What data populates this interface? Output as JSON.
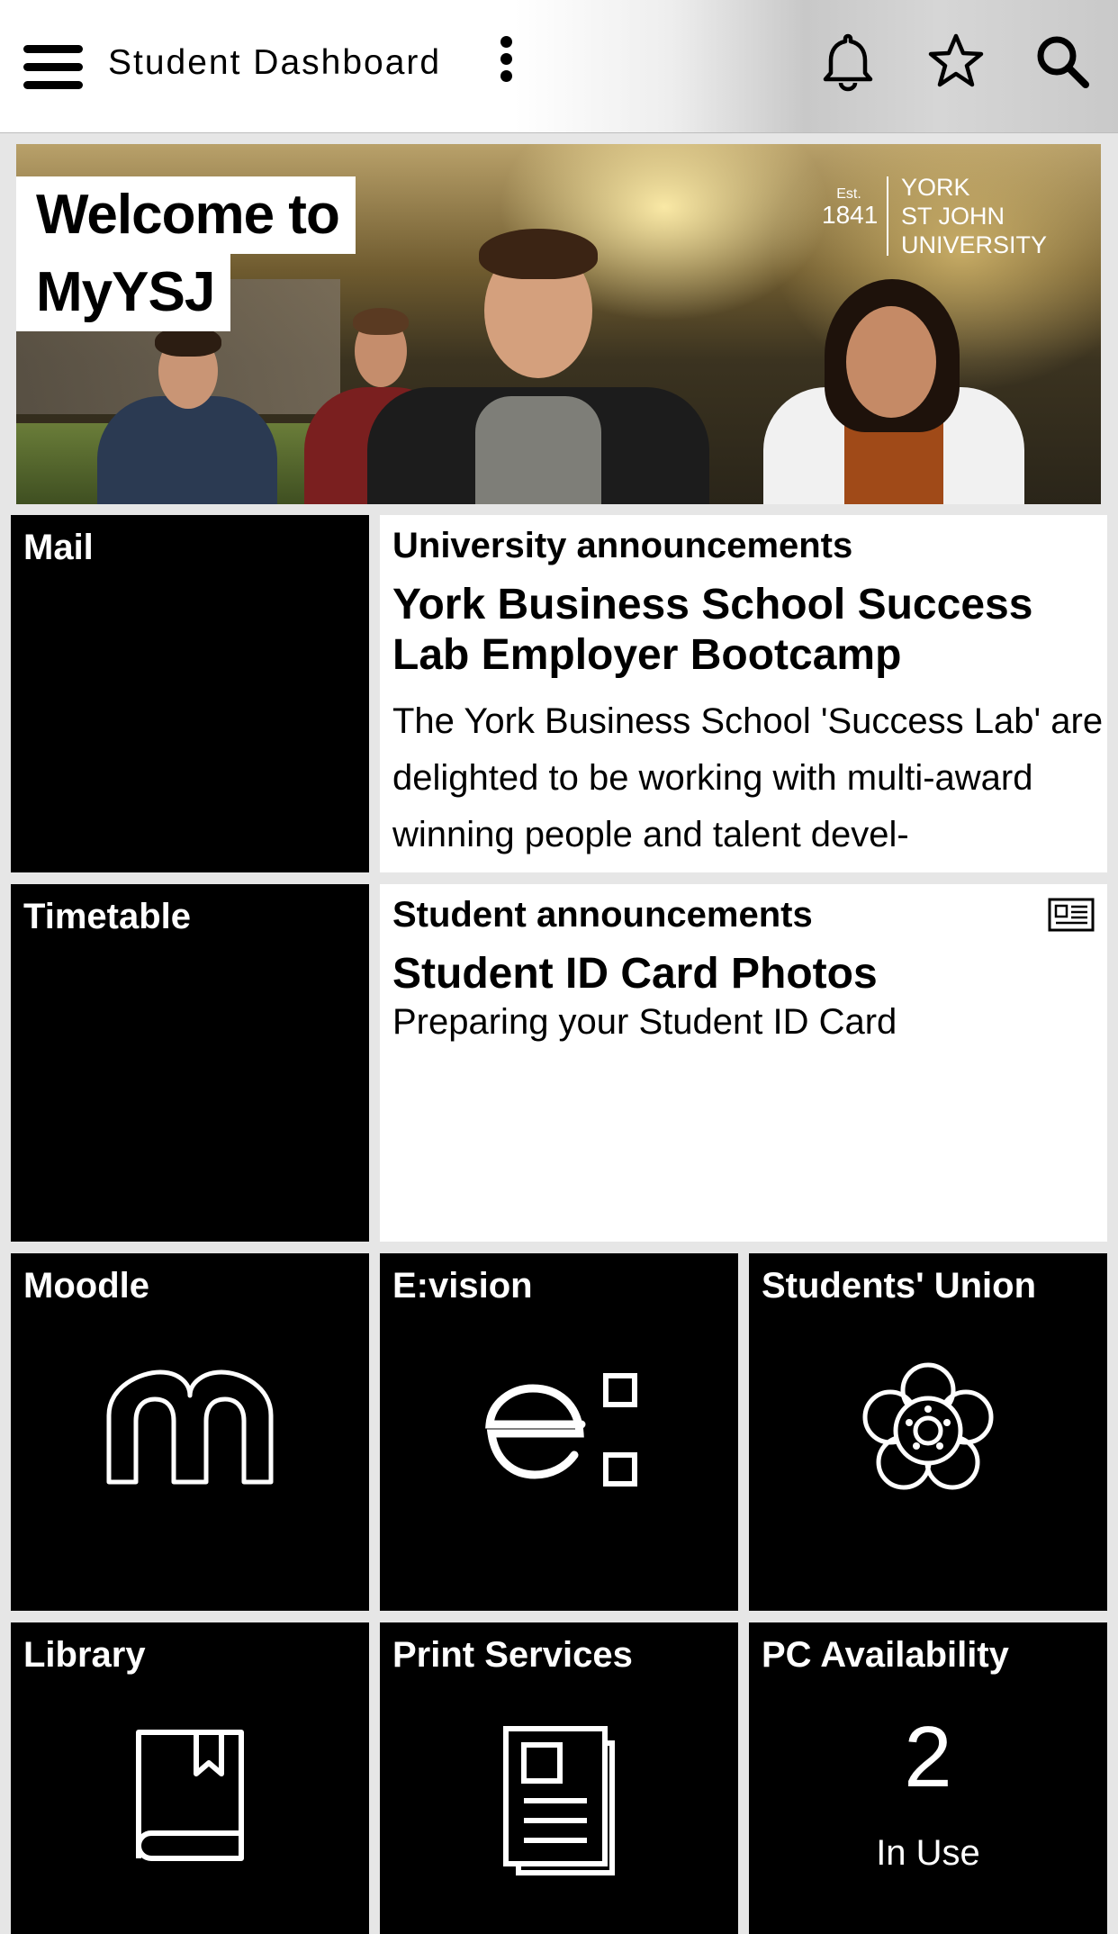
{
  "header": {
    "title": "Student Dashboard"
  },
  "hero": {
    "welcome_line1": "Welcome to",
    "welcome_line2": "MyYSJ",
    "logo": {
      "est": "Est.",
      "year": "1841",
      "name_line1": "YORK",
      "name_line2": "ST JOHN",
      "name_line3": "UNIVERSITY"
    }
  },
  "tiles": {
    "mail": {
      "label": "Mail"
    },
    "university_announcements": {
      "label": "University announcements",
      "headline": "York Business School Success Lab Employer Bootcamp",
      "body": "The York Business School 'Success Lab' are delighted to be working with multi-award winning people and talent devel-"
    },
    "timetable": {
      "label": "Timetable"
    },
    "student_announcements": {
      "label": "Student announcements",
      "headline": "Student ID Card Photos",
      "body": "Preparing your Student ID Card"
    },
    "moodle": {
      "label": "Moodle",
      "icon": "moodle-m-icon"
    },
    "evision": {
      "label": "E:vision",
      "icon": "evision-logo-icon"
    },
    "students_union": {
      "label": "Students' Union",
      "icon": "rose-icon"
    },
    "library": {
      "label": "Library",
      "icon": "book-icon"
    },
    "print_services": {
      "label": "Print Services",
      "icon": "document-icon"
    },
    "pc_availability": {
      "label": "PC Availability",
      "count": "2",
      "status": "In Use"
    }
  },
  "colors": {
    "tile_dark": "#000000",
    "tile_light": "#ffffff",
    "background": "#e6e6e6"
  }
}
